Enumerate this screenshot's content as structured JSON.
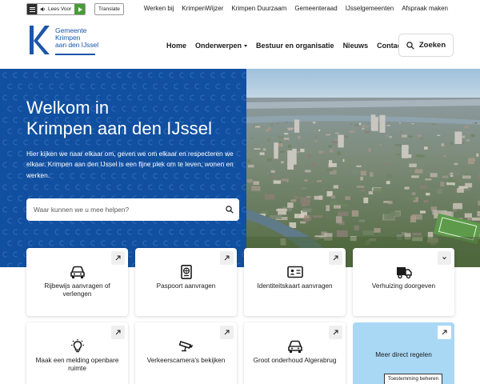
{
  "accessibility": {
    "readspeaker_label": "Lees Voor",
    "translate_label": "Translate"
  },
  "top_links": [
    "Werken bij",
    "KrimpenWijzer",
    "Krimpen Duurzaam",
    "Gemeenteraad",
    "IJsselgemeenten",
    "Afspraak maken"
  ],
  "logo": {
    "line1": "Gemeente",
    "line2": "Krimpen",
    "line3": "aan den IJssel"
  },
  "main_nav": {
    "home": "Home",
    "onderwerpen": "Onderwerpen",
    "bestuur": "Bestuur en organisatie",
    "nieuws": "Nieuws",
    "contact": "Contact"
  },
  "search_button_label": "Zoeken",
  "hero": {
    "title_line1": "Welkom in",
    "title_line2": "Krimpen aan den IJssel",
    "text": "Hier kijken we naar elkaar om, geven we om elkaar en respecteren we elkaar. Krimpen aan den IJssel is een fijne plek om te leven, wonen en werken.",
    "search_placeholder": "Waar kunnen we u mee helpen?"
  },
  "tiles": [
    {
      "label": "Rijbewijs aanvragen of verlengen",
      "icon": "car-icon"
    },
    {
      "label": "Paspoort aanvragen",
      "icon": "passport-icon"
    },
    {
      "label": "Identiteitskaart aanvragen",
      "icon": "id-card-icon"
    },
    {
      "label": "Verhuizing doorgeven",
      "icon": "truck-icon"
    },
    {
      "label": "Maak een melding openbare ruimte",
      "icon": "lightbulb-icon"
    },
    {
      "label": "Verkeerscamera's bekijken",
      "icon": "camera-icon"
    },
    {
      "label": "Groot onderhoud Algerabrug",
      "icon": "car-icon"
    },
    {
      "label": "Meer direct regelen",
      "icon": "arrow-icon"
    }
  ],
  "consent_label": "Toestemming beheren",
  "colors": {
    "brand_blue": "#114fa0",
    "logo_blue": "#1b56a8",
    "tile_highlight": "#a9d8f5",
    "readspeaker_green": "#4b9b3a"
  }
}
